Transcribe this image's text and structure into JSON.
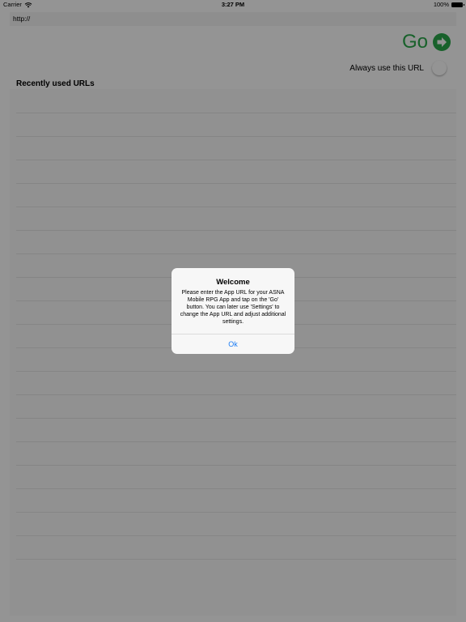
{
  "status_bar": {
    "carrier": "Carrier",
    "time": "3:27 PM",
    "battery": "100%"
  },
  "url_bar": {
    "value": "http://"
  },
  "go_button": {
    "label": "Go",
    "color": "#2aa84a"
  },
  "always_use": {
    "label": "Always use this URL",
    "enabled": false
  },
  "recent": {
    "header": "Recently used URLs",
    "rows": 20
  },
  "alert": {
    "title": "Welcome",
    "message": "Please enter the App URL for your ASNA Mobile RPG App and tap on the 'Go' button. You can later use 'Settings' to change the App URL and adjust additional settings.",
    "ok_label": "Ok",
    "ok_color": "#1a7cf5"
  }
}
